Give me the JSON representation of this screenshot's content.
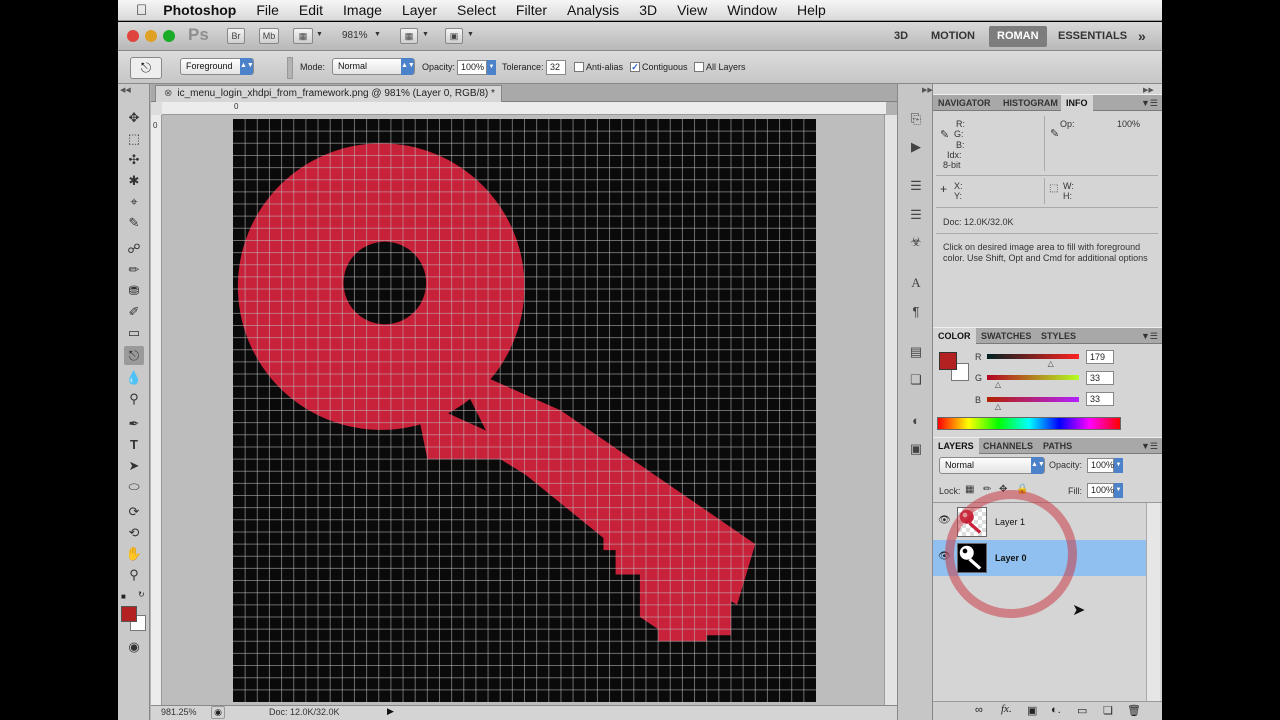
{
  "menubar": {
    "apple": "",
    "items": [
      "Photoshop",
      "File",
      "Edit",
      "Image",
      "Layer",
      "Select",
      "Filter",
      "Analysis",
      "3D",
      "View",
      "Window",
      "Help"
    ]
  },
  "appbar": {
    "ps_logo": "Ps",
    "br_label": "Br",
    "mb_label": "Mb",
    "zoom": "981%",
    "workspaces": [
      "3D",
      "MOTION",
      "ROMAN",
      "ESSENTIALS"
    ],
    "active_workspace": "ROMAN",
    "more": "»"
  },
  "options": {
    "fill_source": "Foreground",
    "mode_label": "Mode:",
    "mode_value": "Normal",
    "opacity_label": "Opacity:",
    "opacity_value": "100%",
    "tolerance_label": "Tolerance:",
    "tolerance_value": "32",
    "antialias_label": "Anti-alias",
    "antialias_checked": false,
    "contiguous_label": "Contiguous",
    "contiguous_checked": true,
    "all_layers_label": "All Layers",
    "all_layers_checked": false
  },
  "document": {
    "tab_title": "ic_menu_login_xhdpi_from_framework.png @ 981% (Layer 0, RGB/8) *",
    "ruler_zero": "0",
    "ruler_left_zero": "0",
    "zoom_status": "981.25%",
    "doc_status": "Doc: 12.0K/32.0K",
    "pixel_grid_cells": 48,
    "key_color": "#c8213a",
    "bg_color": "#0a0a0a"
  },
  "info_panel": {
    "tabs": [
      "NAVIGATOR",
      "HISTOGRAM",
      "INFO"
    ],
    "active": "INFO",
    "labels": [
      "R:",
      "G:",
      "B:",
      "Idx:",
      "8-bit"
    ],
    "op_label": "Op:",
    "op_value": "100%",
    "x_label": "X:",
    "y_label": "Y:",
    "w_label": "W:",
    "h_label": "H:",
    "doc": "Doc: 12.0K/32.0K",
    "hint": "Click on desired image area to fill with foreground color.  Use Shift, Opt and Cmd for additional options"
  },
  "color_panel": {
    "tabs": [
      "COLOR",
      "SWATCHES",
      "STYLES"
    ],
    "active": "COLOR",
    "r_label": "R",
    "g_label": "G",
    "b_label": "B",
    "r": "179",
    "g": "33",
    "b": "33",
    "r_fraction": 0.702,
    "g_fraction": 0.129,
    "b_fraction": 0.129,
    "foreground": "#b32121",
    "background": "#ffffff"
  },
  "layers_panel": {
    "tabs": [
      "LAYERS",
      "CHANNELS",
      "PATHS"
    ],
    "active": "LAYERS",
    "blend_mode": "Normal",
    "opacity_label": "Opacity:",
    "opacity": "100%",
    "lock_label": "Lock:",
    "fill_label": "Fill:",
    "fill": "100%",
    "layers": [
      {
        "name": "Layer 1",
        "selected": false
      },
      {
        "name": "Layer 0",
        "selected": true
      }
    ],
    "footer_icons": [
      "link-icon",
      "fx-icon",
      "mask-icon",
      "adjustment-icon",
      "group-icon",
      "new-layer-icon",
      "trash-icon"
    ]
  }
}
